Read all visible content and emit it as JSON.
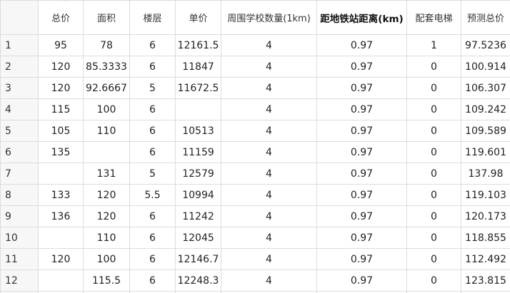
{
  "headers": [
    "",
    "总价",
    "面积",
    "楼层",
    "单价",
    "周围学校数量(1km)",
    "距地铁站距离(km)",
    "配套电梯",
    "预测总价"
  ],
  "rows": [
    [
      "1",
      "95",
      "78",
      "6",
      "12161.5",
      "4",
      "0.97",
      "1",
      "97.5236"
    ],
    [
      "2",
      "120",
      "85.3333",
      "6",
      "11847",
      "4",
      "0.97",
      "0",
      "100.914"
    ],
    [
      "3",
      "120",
      "92.6667",
      "5",
      "11672.5",
      "4",
      "0.97",
      "0",
      "106.307"
    ],
    [
      "4",
      "115",
      "100",
      "6",
      "",
      "4",
      "0.97",
      "0",
      "109.242"
    ],
    [
      "5",
      "105",
      "110",
      "6",
      "10513",
      "4",
      "0.97",
      "0",
      "109.589"
    ],
    [
      "6",
      "135",
      "",
      "6",
      "11159",
      "4",
      "0.97",
      "0",
      "119.601"
    ],
    [
      "7",
      "",
      "131",
      "5",
      "12579",
      "4",
      "0.97",
      "0",
      "137.98"
    ],
    [
      "8",
      "133",
      "120",
      "5.5",
      "10994",
      "4",
      "0.97",
      "0",
      "119.103"
    ],
    [
      "9",
      "136",
      "120",
      "6",
      "11242",
      "4",
      "0.97",
      "0",
      "120.173"
    ],
    [
      "10",
      "",
      "110",
      "6",
      "12045",
      "4",
      "0.97",
      "0",
      "118.855"
    ],
    [
      "11",
      "120",
      "100",
      "6",
      "12146.7",
      "4",
      "0.97",
      "0",
      "112.492"
    ],
    [
      "12",
      "",
      "115.5",
      "6",
      "12248.3",
      "4",
      "0.97",
      "0",
      "123.815"
    ]
  ]
}
